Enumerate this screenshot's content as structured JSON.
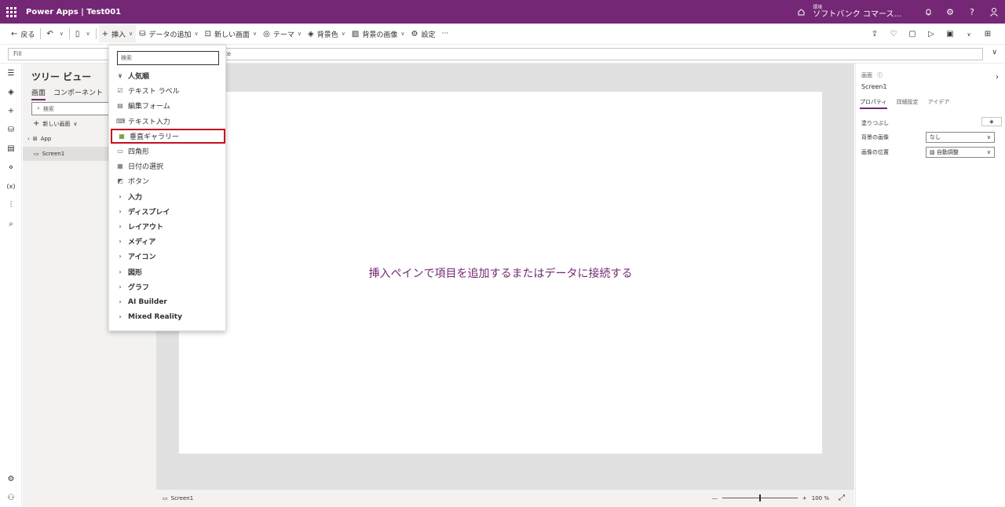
{
  "header": {
    "app_title": "Power Apps  |  Test001",
    "env_label": "環境",
    "env_name": "ソフトバンク コマース..."
  },
  "commandbar": {
    "back": "戻る",
    "insert": "挿入",
    "add_data": "データの追加",
    "new_screen": "新しい画面",
    "theme": "テーマ",
    "background_color": "背景色",
    "background_image": "背景の画像",
    "settings": "設定",
    "more": "···"
  },
  "formulabar": {
    "property": "Fill",
    "formula": "te"
  },
  "tree": {
    "title": "ツリー ビュー",
    "tabs": [
      "画面",
      "コンポーネント"
    ],
    "search_placeholder": "検索",
    "new_screen": "新しい画面",
    "items": [
      "App",
      "Screen1"
    ]
  },
  "insert_menu": {
    "search_placeholder": "検索",
    "items": [
      {
        "label": "人気順",
        "kind": "group-open"
      },
      {
        "label": "テキスト ラベル",
        "kind": "item",
        "icon": "label-icon"
      },
      {
        "label": "編集フォーム",
        "kind": "item",
        "icon": "form-icon"
      },
      {
        "label": "テキスト入力",
        "kind": "item",
        "icon": "text-input-icon"
      },
      {
        "label": "垂直ギャラリー",
        "kind": "item",
        "icon": "gallery-icon"
      },
      {
        "label": "四角形",
        "kind": "item",
        "icon": "rectangle-icon"
      },
      {
        "label": "日付の選択",
        "kind": "item",
        "icon": "calendar-icon"
      },
      {
        "label": "ボタン",
        "kind": "item",
        "icon": "button-icon"
      },
      {
        "label": "入力",
        "kind": "group"
      },
      {
        "label": "ディスプレイ",
        "kind": "group"
      },
      {
        "label": "レイアウト",
        "kind": "group"
      },
      {
        "label": "メディア",
        "kind": "group"
      },
      {
        "label": "アイコン",
        "kind": "group"
      },
      {
        "label": "図形",
        "kind": "group"
      },
      {
        "label": "グラフ",
        "kind": "group"
      },
      {
        "label": "AI Builder",
        "kind": "group"
      },
      {
        "label": "Mixed Reality",
        "kind": "group"
      }
    ]
  },
  "canvas": {
    "placeholder": "挿入ペインで項目を追加するまたはデータに接続する"
  },
  "statusbar": {
    "screen": "Screen1",
    "zoom_minus": "—",
    "zoom_plus": "+",
    "zoom": "100 %",
    "zoom_fraction": 0.5
  },
  "properties": {
    "kind": "画面",
    "name": "Screen1",
    "tabs": [
      "プロパティ",
      "詳細設定",
      "アイデア"
    ],
    "fill_label": "塗りつぶし",
    "bg_image_label": "背景の画像",
    "bg_image_value": "なし",
    "image_position_label": "画像の位置",
    "image_position_value": "自動調整"
  },
  "colors": {
    "brand": "#742774",
    "highlight_border": "#c50f1f"
  }
}
